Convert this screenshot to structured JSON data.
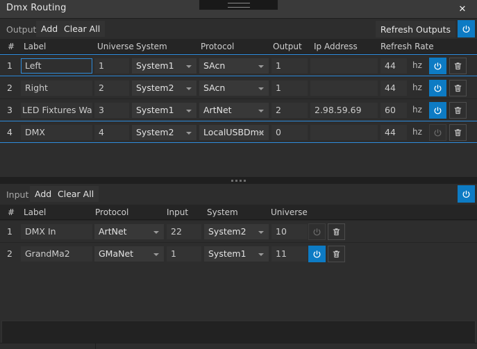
{
  "window": {
    "title": "Dmx Routing",
    "close_label": "✕",
    "accent_color": "#0d7bc4",
    "selection_color": "#2e8ddd",
    "background_color": "#2d2d2d",
    "titlebar_color": "#3a3a3a"
  },
  "output_section": {
    "label": "Output",
    "add_label": "Add",
    "clear_all_label": "Clear All",
    "refresh_label": "Refresh Outputs",
    "power_icon": "power-icon",
    "columns": [
      "#",
      "Label",
      "Universe",
      "System",
      "Protocol",
      "Output",
      "Ip Address",
      "Refresh Rate"
    ],
    "unit": "hz",
    "rows": [
      {
        "index": "1",
        "label": "Left",
        "universe": "1",
        "system": "System1",
        "protocol": "SAcn",
        "output": "1",
        "ip_address": "",
        "refresh_rate": "44",
        "unit": "hz",
        "enabled": true,
        "selected": true,
        "label_focused": true
      },
      {
        "index": "2",
        "label": "Right",
        "universe": "2",
        "system": "System2",
        "protocol": "SAcn",
        "output": "1",
        "ip_address": "",
        "refresh_rate": "44",
        "unit": "hz",
        "enabled": true,
        "selected": false,
        "label_focused": false
      },
      {
        "index": "3",
        "label": "LED Fixtures Wall",
        "universe": "3",
        "system": "System1",
        "protocol": "ArtNet",
        "output": "2",
        "ip_address": "2.98.59.69",
        "refresh_rate": "60",
        "unit": "hz",
        "enabled": true,
        "selected": false,
        "label_focused": false
      },
      {
        "index": "4",
        "label": "DMX",
        "universe": "4",
        "system": "System2",
        "protocol": "LocalUSBDmx",
        "output": "0",
        "ip_address": "",
        "refresh_rate": "44",
        "unit": "hz",
        "enabled": false,
        "selected": true,
        "label_focused": false
      }
    ]
  },
  "input_section": {
    "label": "Input",
    "add_label": "Add",
    "clear_all_label": "Clear All",
    "power_icon": "power-icon",
    "columns": [
      "#",
      "Label",
      "Protocol",
      "Input",
      "System",
      "Universe"
    ],
    "rows": [
      {
        "index": "1",
        "label": "DMX In",
        "protocol": "ArtNet",
        "input": "22",
        "system": "System2",
        "universe": "10",
        "enabled": false,
        "selected": false
      },
      {
        "index": "2",
        "label": "GrandMa2",
        "protocol": "GMaNet",
        "input": "1",
        "system": "System1",
        "universe": "11",
        "enabled": true,
        "selected": false
      }
    ]
  },
  "icons": {
    "power": "power-icon",
    "trash": "trash-icon",
    "close": "close-icon",
    "chevron_down": "chevron-down-icon",
    "drag_handle": "drag-handle-icon",
    "splitter": "splitter-grip-icon"
  }
}
